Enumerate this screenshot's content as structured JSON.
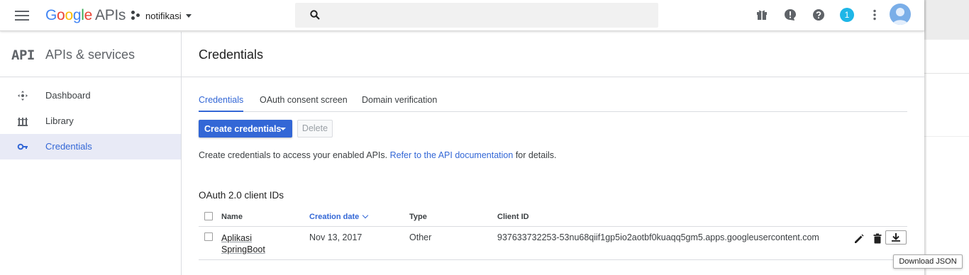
{
  "header": {
    "logo_letters": [
      "G",
      "o",
      "o",
      "g",
      "l",
      "e"
    ],
    "logo_suffix": "APIs",
    "project_name": "notifikasi",
    "search_placeholder": "",
    "notification_count": "1",
    "icons": [
      "menu-icon",
      "gift-icon",
      "alert-icon",
      "help-icon",
      "more-vert-icon",
      "account-icon"
    ],
    "logo_colors": [
      "#4285f4",
      "#ea4335",
      "#fbbc05",
      "#4285f4",
      "#34a853",
      "#ea4335"
    ]
  },
  "sidebar": {
    "api_mark": "API",
    "title": "APIs & services",
    "items": [
      {
        "label": "Dashboard",
        "icon": "dashboard-icon",
        "active": false
      },
      {
        "label": "Library",
        "icon": "library-icon",
        "active": false
      },
      {
        "label": "Credentials",
        "icon": "key-icon",
        "active": true
      }
    ]
  },
  "main": {
    "page_title": "Credentials",
    "tabs": [
      {
        "label": "Credentials",
        "active": true
      },
      {
        "label": "OAuth consent screen",
        "active": false
      },
      {
        "label": "Domain verification",
        "active": false
      }
    ],
    "create_button": "Create credentials",
    "delete_button": "Delete",
    "info_text": "Create credentials to access your enabled APIs.",
    "info_link": "Refer to the API documentation",
    "info_suffix": "for details.",
    "section_title": "OAuth 2.0 client IDs",
    "table": {
      "columns": [
        "Name",
        "Creation date",
        "Type",
        "Client ID"
      ],
      "sorted_column": "Creation date",
      "rows": [
        {
          "name_line1": "Aplikasi",
          "name_line2": "SpringBoot",
          "creation_date": "Nov 13, 2017",
          "type": "Other",
          "client_id": "937633732253-53nu68qiif1gp5io2aotbf0kuaqq5gm5.apps.googleusercontent.com"
        }
      ]
    },
    "tooltip": "Download JSON"
  },
  "colors": {
    "accent": "#3367d6",
    "badge": "#1eb6e7",
    "active_bg": "#e8eaf6"
  }
}
